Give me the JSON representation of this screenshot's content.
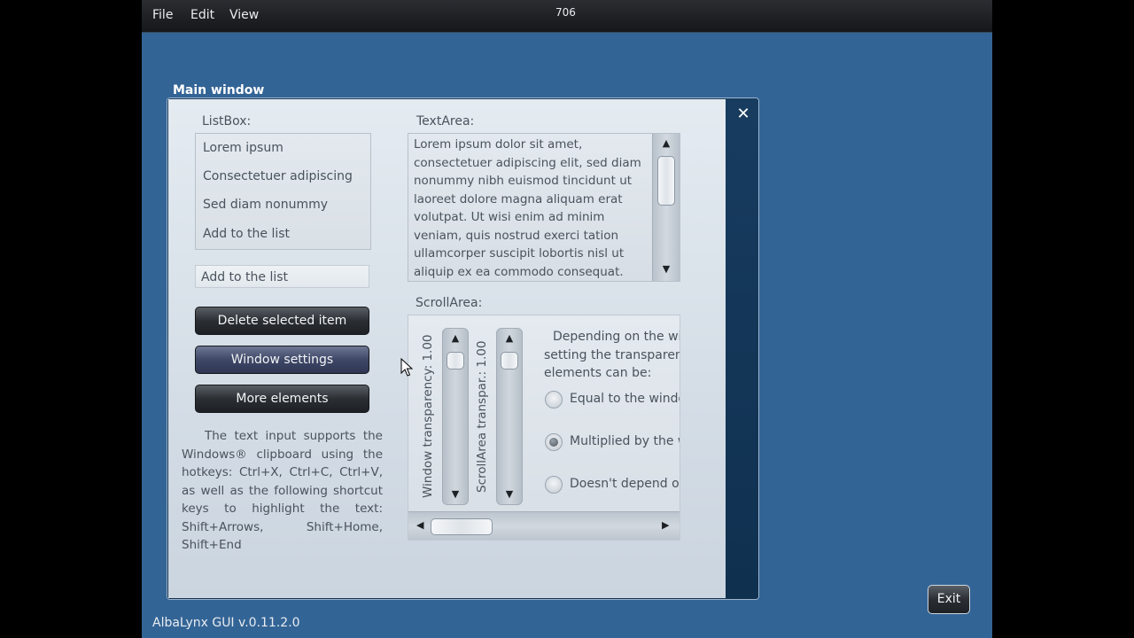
{
  "menu": {
    "file": "File",
    "edit": "Edit",
    "view": "View"
  },
  "fps": "706",
  "window": {
    "title": "Main window"
  },
  "listbox": {
    "label": "ListBox:",
    "items": [
      "Lorem ipsum",
      "Consectetuer adipiscing",
      "Sed diam nonummy",
      "Add to the list"
    ]
  },
  "input": {
    "value": "Add to the list"
  },
  "buttons": {
    "delete": "Delete selected item",
    "settings": "Window settings",
    "more": "More elements"
  },
  "info_text": "The text input supports the Windows® clipboard using the hotkeys: Ctrl+X, Ctrl+C, Ctrl+V, as well as the following shortcut keys to highlight the text: Shift+Arrows, Shift+Home, Shift+End",
  "textarea": {
    "label": "TextArea:",
    "text": "Lorem ipsum dolor sit amet, consectetuer adipiscing elit, sed diam nonummy nibh euismod tincidunt ut laoreet dolore magna aliquam erat volutpat. Ut wisi enim ad minim veniam, quis nostrud exerci tation ullamcorper suscipit lobortis nisl ut aliquip ex ea commodo consequat."
  },
  "scrollarea": {
    "label": "ScrollArea:",
    "slider1_label": "Window transparency: 1.00",
    "slider2_label": "ScrollArea transpar.: 1.00",
    "description_lines": [
      "Depending on the wi",
      "setting the transparenc",
      "elements can be:"
    ],
    "radios": [
      {
        "label": "Equal to the windo",
        "checked": false
      },
      {
        "label": "Multiplied by the w",
        "checked": true
      },
      {
        "label": "Doesn't depend or",
        "checked": false
      }
    ]
  },
  "status": "AlbaLynx GUI v.0.11.2.0",
  "exit": "Exit",
  "colors": {
    "desktop": "#336496",
    "menubar": "#1e2124",
    "panel": "#dde4ea"
  },
  "icons": [
    "close-icon",
    "arrow-up-icon",
    "arrow-down-icon",
    "arrow-left-icon",
    "arrow-right-icon",
    "mouse-pointer-icon"
  ]
}
